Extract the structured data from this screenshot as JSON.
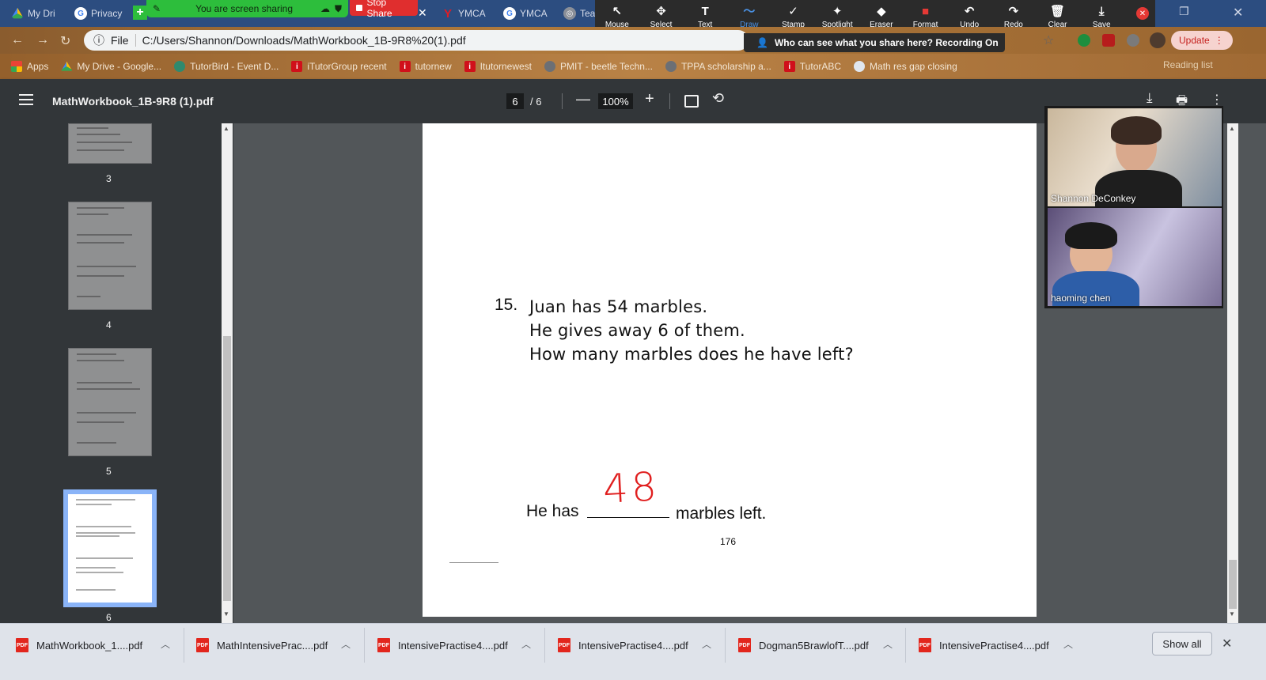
{
  "tabs": [
    {
      "title": "My Dri",
      "icon": "google-drive-icon"
    },
    {
      "title": "Privacy",
      "icon": "google-icon"
    },
    {
      "title": "YMCA",
      "icon": "ymca-icon"
    },
    {
      "title": "YMCA",
      "icon": "google-icon"
    },
    {
      "title": "Tea",
      "icon": "globe-icon"
    }
  ],
  "share": {
    "status": "You are screen sharing",
    "stop_label": "Stop Share"
  },
  "annotation_tools": [
    {
      "label": "Mouse",
      "icon": "↖"
    },
    {
      "label": "Select",
      "icon": "✥"
    },
    {
      "label": "Text",
      "icon": "T"
    },
    {
      "label": "Draw",
      "icon": "〜"
    },
    {
      "label": "Stamp",
      "icon": "✓"
    },
    {
      "label": "Spotlight",
      "icon": "✦"
    },
    {
      "label": "Eraser",
      "icon": "◆"
    },
    {
      "label": "Format",
      "icon": "■"
    },
    {
      "label": "Undo",
      "icon": "↶"
    },
    {
      "label": "Redo",
      "icon": "↷"
    },
    {
      "label": "Clear",
      "icon": "🗑"
    },
    {
      "label": "Save",
      "icon": "⤓"
    }
  ],
  "colors": {
    "draw_active": "#4a90e2",
    "format_red": "#e53935",
    "answer_red": "#e01f1f"
  },
  "address": {
    "scheme_label": "File",
    "url": "C:/Users/Shannon/Downloads/MathWorkbook_1B-9R8%20(1).pdf"
  },
  "recording_notice": "Who can see what you share here? Recording On",
  "update_label": "Update",
  "bookmarks": [
    {
      "label": "Apps",
      "icon": "grid"
    },
    {
      "label": "My Drive - Google...",
      "icon": "drive"
    },
    {
      "label": "TutorBird - Event D...",
      "icon": "teal"
    },
    {
      "label": "iTutorGroup recent",
      "icon": "red"
    },
    {
      "label": "tutornew",
      "icon": "red"
    },
    {
      "label": "Itutornewest",
      "icon": "red"
    },
    {
      "label": "PMIT - beetle Techn...",
      "icon": "gray"
    },
    {
      "label": "TPPA scholarship a...",
      "icon": "gray"
    },
    {
      "label": "TutorABC",
      "icon": "red"
    },
    {
      "label": "Math res gap closing",
      "icon": "globe"
    }
  ],
  "reading_list": "Reading list",
  "pdf": {
    "title": "MathWorkbook_1B-9R8 (1).pdf",
    "current_page": "6",
    "total_pages": "/  6",
    "zoom": "100%",
    "thumb_pages": [
      "3",
      "4",
      "5",
      "6"
    ]
  },
  "question": {
    "number": "15.",
    "lines": [
      "Juan has 54 marbles.",
      "He gives away 6 of them.",
      "How many marbles does he have left?"
    ],
    "answer_prefix": "He has",
    "answer_value": "48",
    "answer_suffix": "marbles left.",
    "page_number": "176"
  },
  "participants": [
    {
      "name": "Shannon DeConkey"
    },
    {
      "name": "haoming   chen"
    }
  ],
  "downloads": [
    "MathWorkbook_1....pdf",
    "MathIntensivePrac....pdf",
    "IntensivePractise4....pdf",
    "IntensivePractise4....pdf",
    "Dogman5BrawlofT....pdf",
    "IntensivePractise4....pdf"
  ],
  "show_all_label": "Show all"
}
